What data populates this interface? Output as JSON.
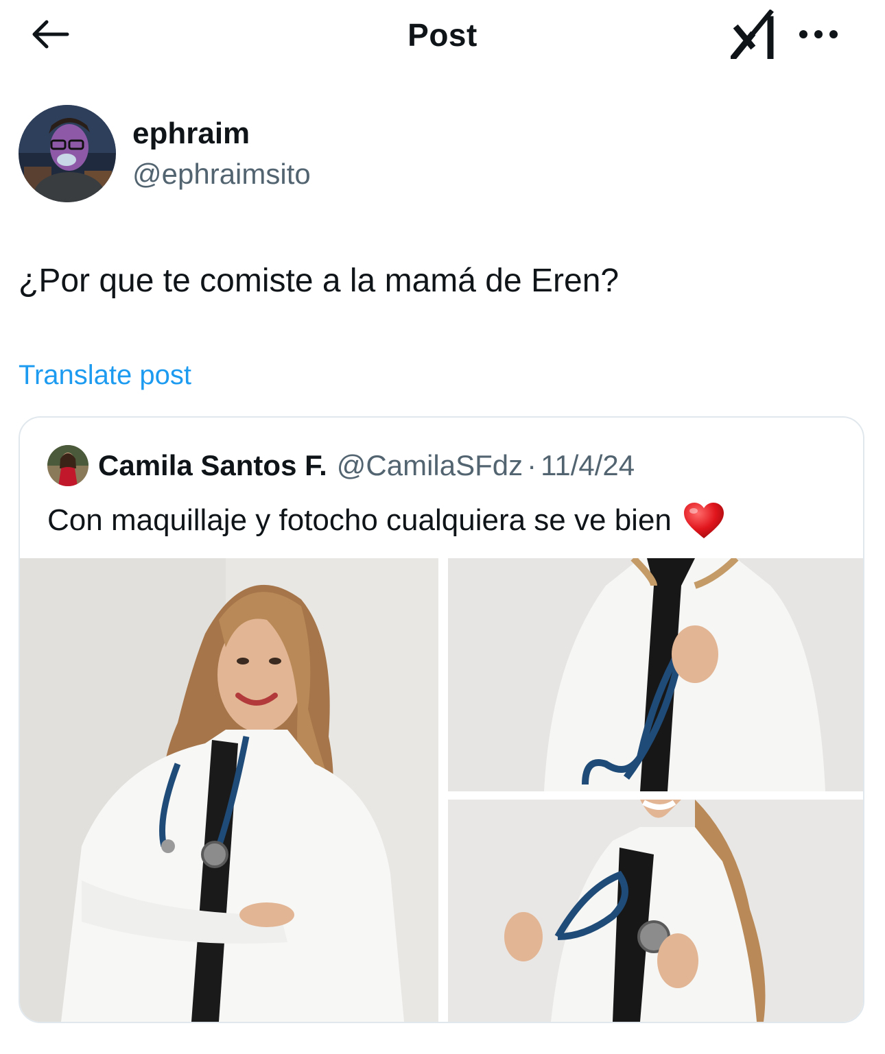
{
  "header": {
    "title": "Post",
    "back_icon": "arrow-left-icon",
    "grok_icon": "grok-icon",
    "more_icon": "more-horizontal-icon"
  },
  "author": {
    "name": "ephraim",
    "handle": "@ephraimsito",
    "avatar": "cartoon-man-avatar"
  },
  "post": {
    "text": "¿Por que te comiste a la mamá de Eren?",
    "translate_label": "Translate post"
  },
  "quote": {
    "name": "Camila Santos F.",
    "handle": "@CamilaSFdz",
    "separator": "·",
    "date": "11/4/24",
    "text": "Con maquillaje y fotocho cualquiera se ve bien",
    "emoji_icon": "red-heart-icon",
    "images": [
      "woman-in-white-coat-with-stethoscope-arms-crossed",
      "holding-stethoscope-closeup",
      "smiling-with-stethoscope-closeup"
    ]
  },
  "colors": {
    "text": "#0f1419",
    "secondary": "#536471",
    "link": "#1d9bf0",
    "border": "#e1e8ed"
  }
}
